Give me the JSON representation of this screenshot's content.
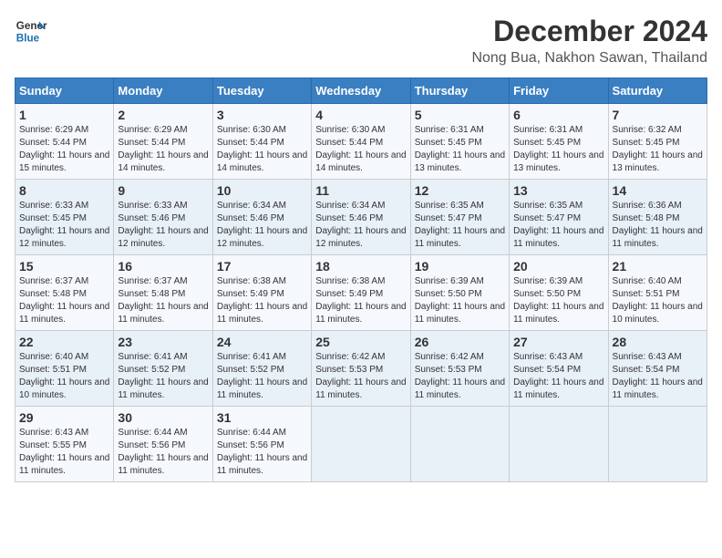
{
  "header": {
    "logo_line1": "General",
    "logo_line2": "Blue",
    "title": "December 2024",
    "subtitle": "Nong Bua, Nakhon Sawan, Thailand"
  },
  "calendar": {
    "days_of_week": [
      "Sunday",
      "Monday",
      "Tuesday",
      "Wednesday",
      "Thursday",
      "Friday",
      "Saturday"
    ],
    "weeks": [
      [
        {
          "day": "1",
          "sunrise": "6:29 AM",
          "sunset": "5:44 PM",
          "daylight": "11 hours and 15 minutes."
        },
        {
          "day": "2",
          "sunrise": "6:29 AM",
          "sunset": "5:44 PM",
          "daylight": "11 hours and 14 minutes."
        },
        {
          "day": "3",
          "sunrise": "6:30 AM",
          "sunset": "5:44 PM",
          "daylight": "11 hours and 14 minutes."
        },
        {
          "day": "4",
          "sunrise": "6:30 AM",
          "sunset": "5:44 PM",
          "daylight": "11 hours and 14 minutes."
        },
        {
          "day": "5",
          "sunrise": "6:31 AM",
          "sunset": "5:45 PM",
          "daylight": "11 hours and 13 minutes."
        },
        {
          "day": "6",
          "sunrise": "6:31 AM",
          "sunset": "5:45 PM",
          "daylight": "11 hours and 13 minutes."
        },
        {
          "day": "7",
          "sunrise": "6:32 AM",
          "sunset": "5:45 PM",
          "daylight": "11 hours and 13 minutes."
        }
      ],
      [
        {
          "day": "8",
          "sunrise": "6:33 AM",
          "sunset": "5:45 PM",
          "daylight": "11 hours and 12 minutes."
        },
        {
          "day": "9",
          "sunrise": "6:33 AM",
          "sunset": "5:46 PM",
          "daylight": "11 hours and 12 minutes."
        },
        {
          "day": "10",
          "sunrise": "6:34 AM",
          "sunset": "5:46 PM",
          "daylight": "11 hours and 12 minutes."
        },
        {
          "day": "11",
          "sunrise": "6:34 AM",
          "sunset": "5:46 PM",
          "daylight": "11 hours and 12 minutes."
        },
        {
          "day": "12",
          "sunrise": "6:35 AM",
          "sunset": "5:47 PM",
          "daylight": "11 hours and 11 minutes."
        },
        {
          "day": "13",
          "sunrise": "6:35 AM",
          "sunset": "5:47 PM",
          "daylight": "11 hours and 11 minutes."
        },
        {
          "day": "14",
          "sunrise": "6:36 AM",
          "sunset": "5:48 PM",
          "daylight": "11 hours and 11 minutes."
        }
      ],
      [
        {
          "day": "15",
          "sunrise": "6:37 AM",
          "sunset": "5:48 PM",
          "daylight": "11 hours and 11 minutes."
        },
        {
          "day": "16",
          "sunrise": "6:37 AM",
          "sunset": "5:48 PM",
          "daylight": "11 hours and 11 minutes."
        },
        {
          "day": "17",
          "sunrise": "6:38 AM",
          "sunset": "5:49 PM",
          "daylight": "11 hours and 11 minutes."
        },
        {
          "day": "18",
          "sunrise": "6:38 AM",
          "sunset": "5:49 PM",
          "daylight": "11 hours and 11 minutes."
        },
        {
          "day": "19",
          "sunrise": "6:39 AM",
          "sunset": "5:50 PM",
          "daylight": "11 hours and 11 minutes."
        },
        {
          "day": "20",
          "sunrise": "6:39 AM",
          "sunset": "5:50 PM",
          "daylight": "11 hours and 11 minutes."
        },
        {
          "day": "21",
          "sunrise": "6:40 AM",
          "sunset": "5:51 PM",
          "daylight": "11 hours and 10 minutes."
        }
      ],
      [
        {
          "day": "22",
          "sunrise": "6:40 AM",
          "sunset": "5:51 PM",
          "daylight": "11 hours and 10 minutes."
        },
        {
          "day": "23",
          "sunrise": "6:41 AM",
          "sunset": "5:52 PM",
          "daylight": "11 hours and 11 minutes."
        },
        {
          "day": "24",
          "sunrise": "6:41 AM",
          "sunset": "5:52 PM",
          "daylight": "11 hours and 11 minutes."
        },
        {
          "day": "25",
          "sunrise": "6:42 AM",
          "sunset": "5:53 PM",
          "daylight": "11 hours and 11 minutes."
        },
        {
          "day": "26",
          "sunrise": "6:42 AM",
          "sunset": "5:53 PM",
          "daylight": "11 hours and 11 minutes."
        },
        {
          "day": "27",
          "sunrise": "6:43 AM",
          "sunset": "5:54 PM",
          "daylight": "11 hours and 11 minutes."
        },
        {
          "day": "28",
          "sunrise": "6:43 AM",
          "sunset": "5:54 PM",
          "daylight": "11 hours and 11 minutes."
        }
      ],
      [
        {
          "day": "29",
          "sunrise": "6:43 AM",
          "sunset": "5:55 PM",
          "daylight": "11 hours and 11 minutes."
        },
        {
          "day": "30",
          "sunrise": "6:44 AM",
          "sunset": "5:56 PM",
          "daylight": "11 hours and 11 minutes."
        },
        {
          "day": "31",
          "sunrise": "6:44 AM",
          "sunset": "5:56 PM",
          "daylight": "11 hours and 11 minutes."
        },
        null,
        null,
        null,
        null
      ]
    ]
  }
}
